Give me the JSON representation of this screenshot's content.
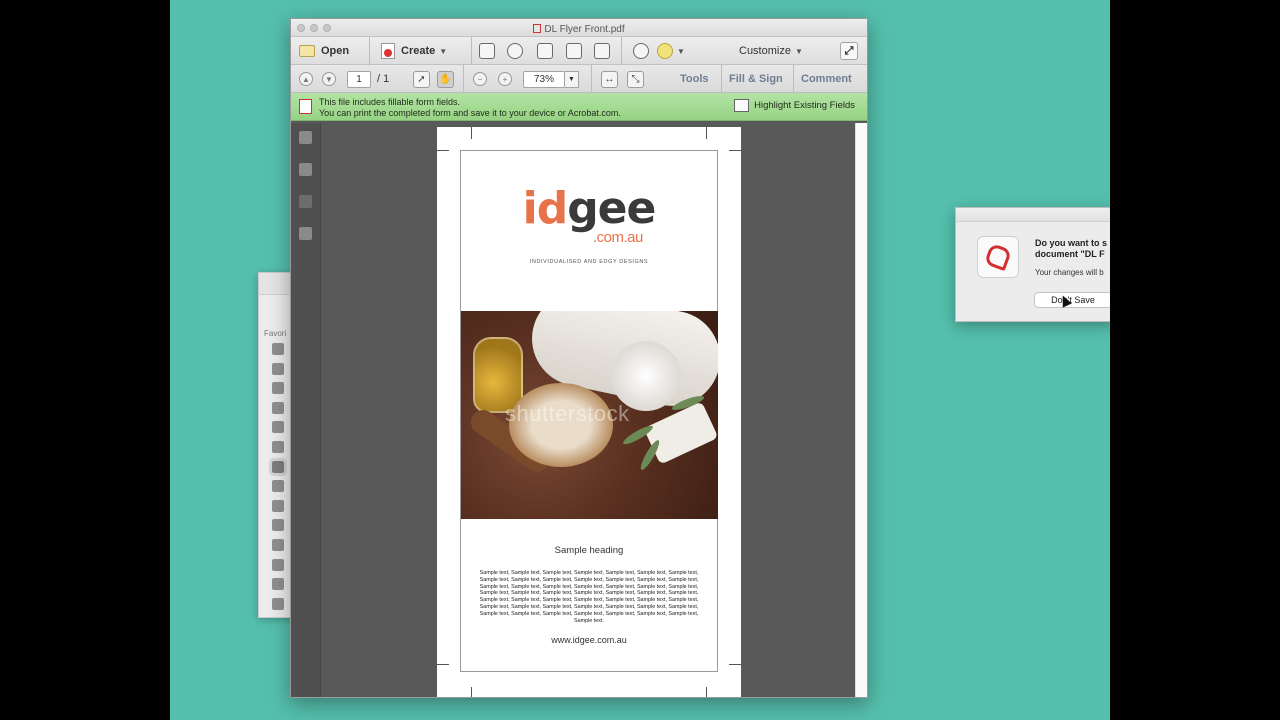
{
  "window": {
    "title": "DL Flyer Front.pdf"
  },
  "toolbar": {
    "open_label": "Open",
    "create_label": "Create",
    "customize_label": "Customize"
  },
  "nav": {
    "page_current": "1",
    "page_total": "/ 1",
    "zoom": "73%",
    "tabs": [
      "Tools",
      "Fill & Sign",
      "Comment"
    ]
  },
  "form_notice": {
    "line1": "This file includes fillable form fields.",
    "line2": "You can print the completed form and save it to your device or Acrobat.com.",
    "highlight_label": "Highlight Existing Fields"
  },
  "flyer": {
    "logo_id": "id",
    "logo_gee": "gee",
    "logo_domain": ".com.au",
    "logo_tagline": "INDIVIDUALISED AND EDGY DESIGNS",
    "watermark": "shutterstock",
    "heading": "Sample heading",
    "body": "Sample text, Sample text, Sample text, Sample text, Sample text, Sample text, Sample text, Sample text, Sample text, Sample text, Sample text, Sample text, Sample text, Sample text, Sample text, Sample text, Sample text, Sample text, Sample text, Sample text, Sample text, Sample text, Sample text, Sample text, Sample text, Sample text, Sample text, Sample text, Sample text, Sample text, Sample text, Sample text, Sample text, Sample text, Sample text, Sample text, Sample text, Sample text, Sample text, Sample text, Sample text, Sample text, Sample text, Sample text, Sample text, Sample text, Sample text, Sample text, Sample text, Sample text.",
    "website": "www.idgee.com.au"
  },
  "finder": {
    "label": "Favori"
  },
  "dialog": {
    "question_line1": "Do you want to s",
    "question_line2": "document \"DL F",
    "subtext": "Your changes will b",
    "dont_save_label": "Don't Save"
  },
  "colors": {
    "desktop": "#55bfad",
    "brand_orange": "#e8734a",
    "form_bar": "#a5dc92",
    "acrobat_red": "#d32f2f"
  }
}
